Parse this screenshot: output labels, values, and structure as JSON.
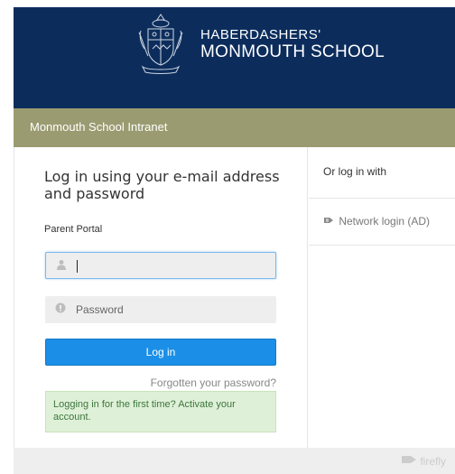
{
  "header": {
    "school_name_line1": "HABERDASHERS'",
    "school_name_line2": "MONMOUTH SCHOOL"
  },
  "intranet_bar": {
    "title": "Monmouth School Intranet"
  },
  "login": {
    "heading": "Log in using your e-mail address and password",
    "sublabel": "Parent Portal",
    "username_value": "",
    "password_placeholder": "Password",
    "login_button": "Log in",
    "forgot_link": "Forgotten your password?",
    "first_time_notice": "Logging in for the first time? Activate your account."
  },
  "alt_login": {
    "heading": "Or log in with",
    "network_login": "Network login (AD)"
  },
  "footer": {
    "brand": "firefly"
  },
  "colors": {
    "header_bg": "#0c2d5c",
    "intranet_bar_bg": "#9b9b72",
    "login_button_bg": "#1b8fe8",
    "notice_bg": "#dff0d8",
    "notice_text": "#3c763d"
  }
}
